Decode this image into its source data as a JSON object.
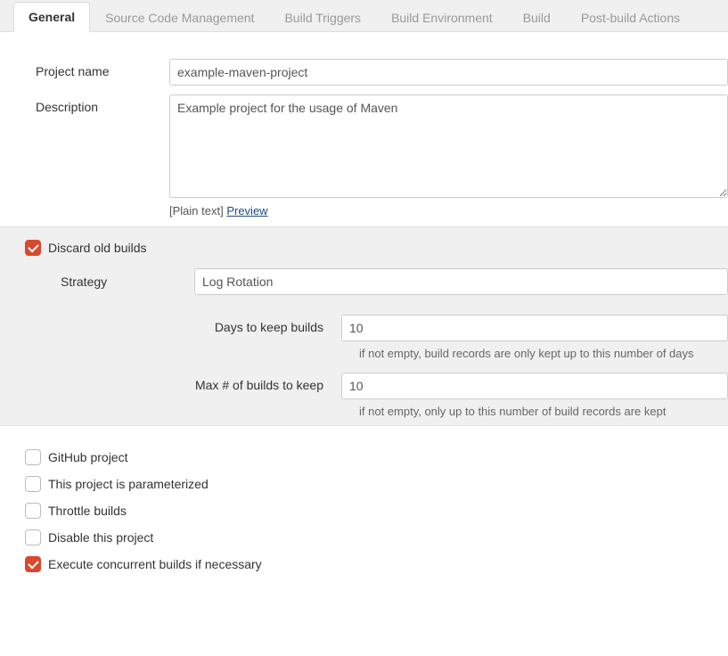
{
  "tabs": {
    "general": "General",
    "scm": "Source Code Management",
    "triggers": "Build Triggers",
    "env": "Build Environment",
    "build": "Build",
    "post": "Post-build Actions"
  },
  "labels": {
    "project_name": "Project name",
    "description": "Description",
    "plain_text": "[Plain text]",
    "preview": "Preview",
    "discard_old": "Discard old builds",
    "strategy": "Strategy",
    "days_keep": "Days to keep builds",
    "days_help": "if not empty, build records are only kept up to this number of days",
    "max_num": "Max # of builds to keep",
    "max_help": "if not empty, only up to this number of build records are kept",
    "github": "GitHub project",
    "parameterized": "This project is parameterized",
    "throttle": "Throttle builds",
    "disable": "Disable this project",
    "concurrent": "Execute concurrent builds if necessary"
  },
  "values": {
    "project_name": "example-maven-project",
    "description": "Example project for the usage of Maven",
    "strategy": "Log Rotation",
    "days": "10",
    "max": "10"
  },
  "checks": {
    "discard_old": true,
    "github": false,
    "parameterized": false,
    "throttle": false,
    "disable": false,
    "concurrent": true
  }
}
